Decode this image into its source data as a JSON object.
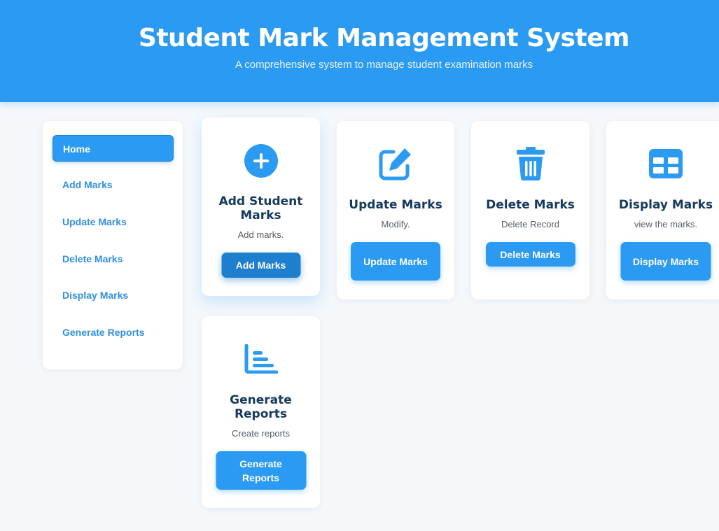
{
  "header": {
    "title": "Student Mark Management System",
    "subtitle": "A comprehensive system to manage student examination marks"
  },
  "sidebar": {
    "items": [
      {
        "label": "Home",
        "active": true
      },
      {
        "label": "Add Marks"
      },
      {
        "label": "Update Marks"
      },
      {
        "label": "Delete Marks"
      },
      {
        "label": "Display Marks"
      },
      {
        "label": "Generate Reports"
      }
    ]
  },
  "cards": {
    "add": {
      "title": "Add Student Marks",
      "description": "Add marks.",
      "button": "Add Marks",
      "icon": "plus-circle-icon"
    },
    "update": {
      "title": "Update Marks",
      "description": "Modify.",
      "button": "Update Marks",
      "icon": "edit-icon"
    },
    "delete": {
      "title": "Delete Marks",
      "description": "Delete Record",
      "button": "Delete Marks",
      "icon": "trash-icon"
    },
    "display": {
      "title": "Display Marks",
      "description": "view the marks.",
      "button": "Display Marks",
      "icon": "table-icon"
    },
    "reports": {
      "title": "Generate Reports",
      "description": "Create reports",
      "button": "Generate Reports",
      "icon": "bar-chart-icon"
    }
  },
  "colors": {
    "primary": "#2b9af3",
    "primary_dark": "#1f7fcf",
    "heading": "#163a5e",
    "background": "#f5f8fb"
  }
}
